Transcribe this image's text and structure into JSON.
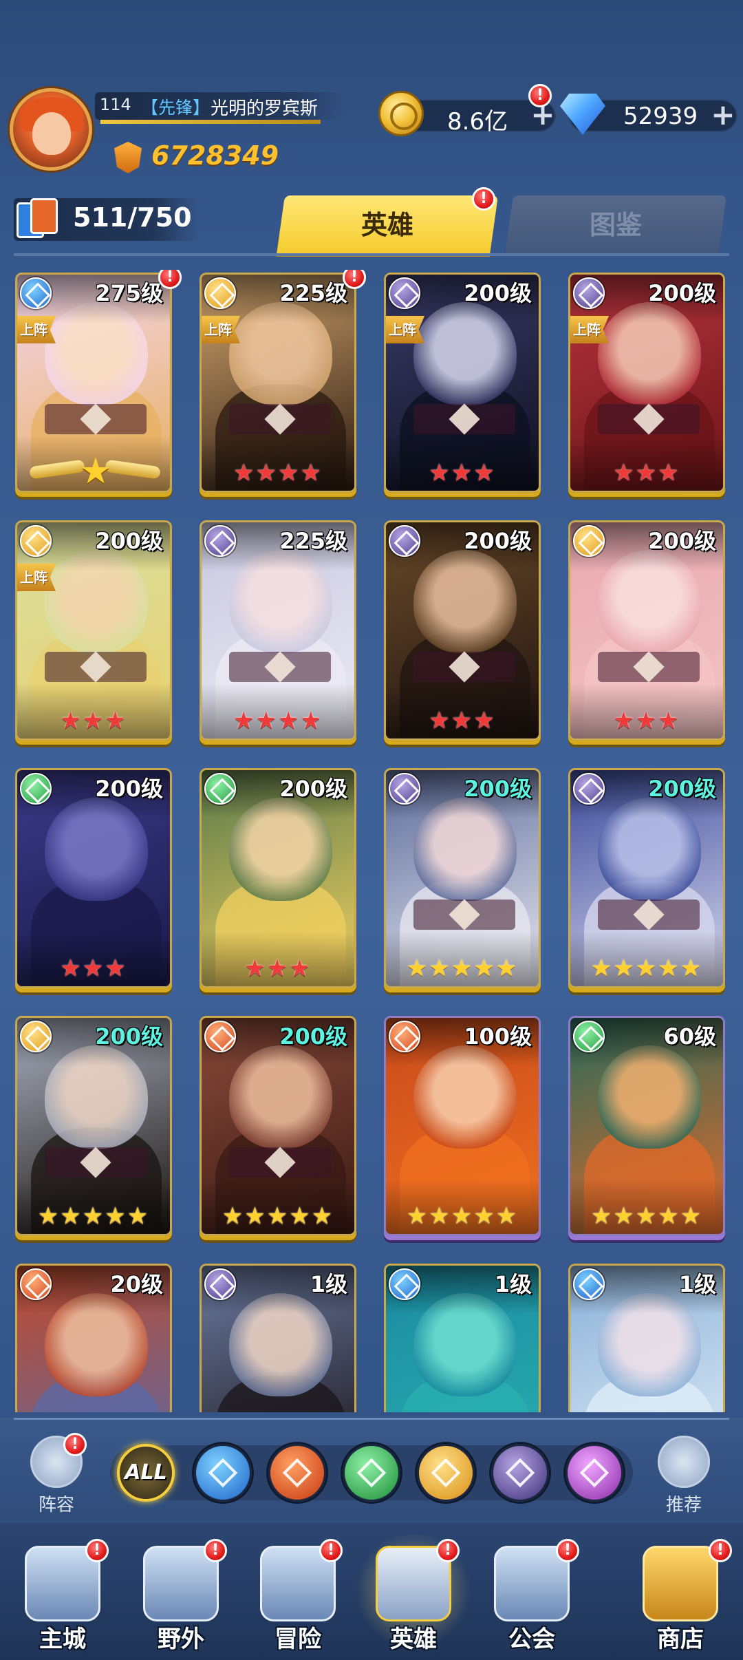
{
  "player": {
    "level": "114",
    "role": "【先锋】",
    "name": "光明的罗宾斯",
    "power": "6728349"
  },
  "resources": {
    "gold": "8.6亿",
    "gems": "52939",
    "plus": "+"
  },
  "roster": {
    "count": "511/750"
  },
  "tabs": {
    "heroes": "英雄",
    "codex": "图鉴"
  },
  "badge": "!",
  "on_field_label": "上阵",
  "heroes": [
    {
      "level": "275级",
      "faction": "water-icon",
      "on_field": true,
      "stars": "★",
      "star_color": "wing",
      "notify": true
    },
    {
      "level": "225级",
      "faction": "light-icon",
      "on_field": true,
      "stars": "★★★★",
      "star_color": "red",
      "notify": true
    },
    {
      "level": "200级",
      "faction": "dark-icon",
      "on_field": true,
      "stars": "★★★",
      "star_color": "red",
      "notify": false
    },
    {
      "level": "200级",
      "faction": "dark-icon",
      "on_field": true,
      "stars": "★★★",
      "star_color": "red",
      "notify": false
    },
    {
      "level": "200级",
      "faction": "light-icon",
      "on_field": true,
      "stars": "★★★",
      "star_color": "red",
      "notify": false
    },
    {
      "level": "225级",
      "faction": "dark-icon",
      "on_field": false,
      "stars": "★★★★",
      "star_color": "red",
      "notify": false
    },
    {
      "level": "200级",
      "faction": "dark-icon",
      "on_field": false,
      "stars": "★★★",
      "star_color": "red",
      "notify": false
    },
    {
      "level": "200级",
      "faction": "light-icon",
      "on_field": false,
      "stars": "★★★",
      "star_color": "red",
      "notify": false
    },
    {
      "level": "200级",
      "faction": "wind-icon",
      "on_field": false,
      "stars": "★★★",
      "star_color": "red",
      "notify": false
    },
    {
      "level": "200级",
      "faction": "wind-icon",
      "on_field": false,
      "stars": "★★★",
      "star_color": "red",
      "notify": false
    },
    {
      "level": "200级",
      "faction": "dark-icon",
      "on_field": false,
      "stars": "★★★★★",
      "star_color": "gold",
      "notify": false
    },
    {
      "level": "200级",
      "faction": "dark-icon",
      "on_field": false,
      "stars": "★★★★★",
      "star_color": "gold",
      "notify": false
    },
    {
      "level": "200级",
      "faction": "light-icon",
      "on_field": false,
      "stars": "★★★★★",
      "star_color": "gold",
      "notify": false
    },
    {
      "level": "200级",
      "faction": "fire-icon",
      "on_field": false,
      "stars": "★★★★★",
      "star_color": "gold",
      "notify": false
    },
    {
      "level": "100级",
      "faction": "fire-icon",
      "on_field": false,
      "stars": "★★★★★",
      "star_color": "gold",
      "notify": false
    },
    {
      "level": "60级",
      "faction": "wind-icon",
      "on_field": false,
      "stars": "★★★★★",
      "star_color": "gold",
      "notify": false
    },
    {
      "level": "20级",
      "faction": "fire-icon",
      "on_field": false,
      "stars": "",
      "star_color": "red",
      "notify": false
    },
    {
      "level": "1级",
      "faction": "dark-icon",
      "on_field": false,
      "stars": "",
      "star_color": "red",
      "notify": false
    },
    {
      "level": "1级",
      "faction": "water-icon",
      "on_field": false,
      "stars": "",
      "star_color": "red",
      "notify": false
    },
    {
      "level": "1级",
      "faction": "water-icon",
      "on_field": false,
      "stars": "",
      "star_color": "red",
      "notify": false
    }
  ],
  "filter": {
    "lineup": "阵容",
    "recommend": "推荐",
    "all": "ALL",
    "factions": [
      "water-icon",
      "fire-icon",
      "wind-icon",
      "light-icon",
      "dark-icon",
      "chaos-icon"
    ]
  },
  "nav": {
    "main_city": "主城",
    "outskirts": "野外",
    "adventure": "冒险",
    "heroes": "英雄",
    "guild": "公会",
    "shop": "商店"
  },
  "colors": {
    "accent_gold": "#f5cf3b",
    "red_dot": "#e31b1b",
    "power": "#ffc02e",
    "level_cyan": "#5ef2e0"
  }
}
